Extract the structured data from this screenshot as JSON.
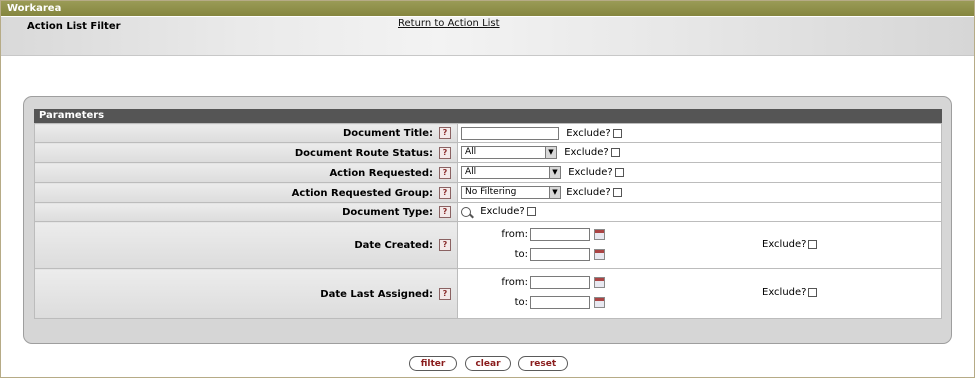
{
  "workarea": {
    "title": "Workarea"
  },
  "header": {
    "title": "Action List Filter",
    "return_link": "Return to Action List"
  },
  "panel": {
    "title": "Parameters"
  },
  "help_glyph": "?",
  "exclude_label": "Exclude?",
  "fields": {
    "document_title": {
      "label": "Document Title:",
      "value": ""
    },
    "document_route_status": {
      "label": "Document Route Status:",
      "selected": "All"
    },
    "action_requested": {
      "label": "Action Requested:",
      "selected": "All"
    },
    "action_requested_group": {
      "label": "Action Requested Group:",
      "selected": "No Filtering"
    },
    "document_type": {
      "label": "Document Type:"
    },
    "date_created": {
      "label": "Date Created:",
      "from_label": "from:",
      "to_label": "to:"
    },
    "date_last_assigned": {
      "label": "Date Last Assigned:",
      "from_label": "from:",
      "to_label": "to:"
    }
  },
  "buttons": {
    "filter": "filter",
    "clear": "clear",
    "reset": "reset"
  },
  "icons": {
    "help": "help-icon",
    "lookup": "magnifier-icon",
    "calendar": "calendar-icon",
    "dropdown": "chevron-down-icon"
  },
  "colors": {
    "workarea_bar": "#8f9049",
    "panel_header": "#555555",
    "button_text": "#8a1c1c"
  }
}
